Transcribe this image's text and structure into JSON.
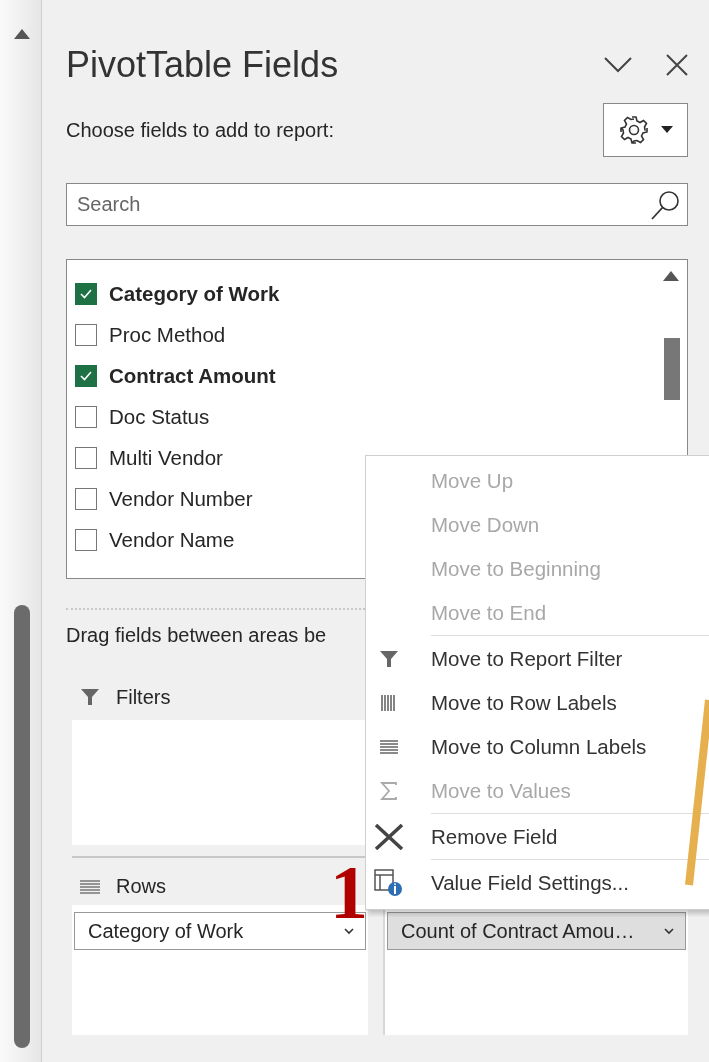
{
  "panel": {
    "title": "PivotTable Fields",
    "subtitle": "Choose fields to add to report:",
    "search": {
      "placeholder": "Search"
    }
  },
  "fields": [
    {
      "label": "Category of Work",
      "checked": true
    },
    {
      "label": "Proc Method",
      "checked": false
    },
    {
      "label": "Contract Amount",
      "checked": true
    },
    {
      "label": "Doc Status",
      "checked": false
    },
    {
      "label": "Multi Vendor",
      "checked": false
    },
    {
      "label": "Vendor Number",
      "checked": false
    },
    {
      "label": "Vendor Name",
      "checked": false
    }
  ],
  "areas_hint": "Drag fields between areas be",
  "areas": {
    "filters": {
      "label": "Filters"
    },
    "rows": {
      "label": "Rows",
      "items": [
        {
          "label": "Category of Work",
          "selected": false
        }
      ]
    },
    "values": {
      "items": [
        {
          "label": "Count of Contract Amou…",
          "selected": true
        }
      ]
    }
  },
  "menu": [
    {
      "label": "Move Up",
      "kind": "none",
      "disabled": true,
      "separator_before": false
    },
    {
      "label": "Move Down",
      "kind": "none",
      "disabled": true,
      "separator_before": false
    },
    {
      "label": "Move to Beginning",
      "kind": "none",
      "disabled": true,
      "separator_before": false
    },
    {
      "label": "Move to End",
      "kind": "none",
      "disabled": true,
      "separator_before": false
    },
    {
      "label": "Move to Report Filter",
      "kind": "filter",
      "disabled": false,
      "separator_before": true
    },
    {
      "label": "Move to Row Labels",
      "kind": "rows",
      "disabled": false,
      "separator_before": false
    },
    {
      "label": "Move to Column Labels",
      "kind": "columns",
      "disabled": false,
      "separator_before": false
    },
    {
      "label": "Move to Values",
      "kind": "sigma",
      "disabled": true,
      "separator_before": false
    },
    {
      "label": "Remove Field",
      "kind": "remove",
      "disabled": false,
      "separator_before": true
    },
    {
      "label": "Value Field Settings...",
      "kind": "settings",
      "disabled": false,
      "separator_before": true
    }
  ],
  "annotation": {
    "label": "1"
  }
}
